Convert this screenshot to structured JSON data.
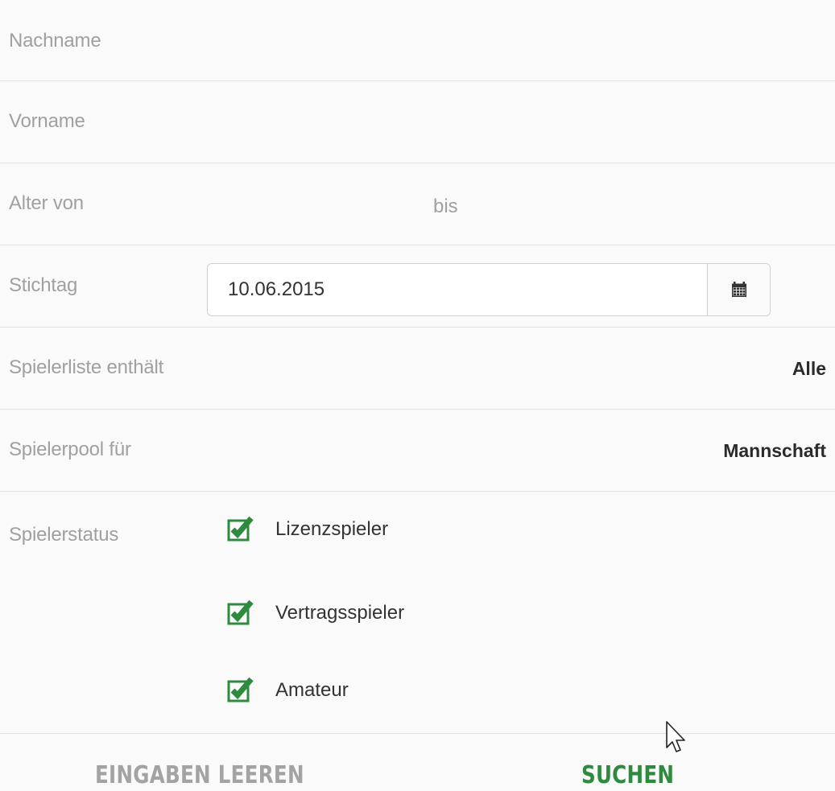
{
  "form": {
    "lastname": {
      "label": "Nachname",
      "value": ""
    },
    "firstname": {
      "label": "Vorname",
      "value": ""
    },
    "age": {
      "label_from": "Alter von",
      "label_to": "bis",
      "from_value": "",
      "to_value": ""
    },
    "reference_date": {
      "label": "Stichtag",
      "value": "10.06.2015",
      "icon": "calendar-icon"
    },
    "player_list": {
      "label": "Spielerliste enthält",
      "value": "Alle"
    },
    "player_pool": {
      "label": "Spielerpool für",
      "value": "Mannschaft"
    },
    "player_status": {
      "label": "Spielerstatus",
      "options": [
        {
          "label": "Lizenzspieler",
          "checked": true
        },
        {
          "label": "Vertragsspieler",
          "checked": true
        },
        {
          "label": "Amateur",
          "checked": true
        }
      ]
    }
  },
  "footer": {
    "clear_label": "EINGABEN LEEREN",
    "search_label": "SUCHEN"
  },
  "colors": {
    "accent": "#2e8a3e",
    "label": "#a0a0a0",
    "disabled": "#a3a3a3",
    "divider": "#e2e2e2"
  }
}
